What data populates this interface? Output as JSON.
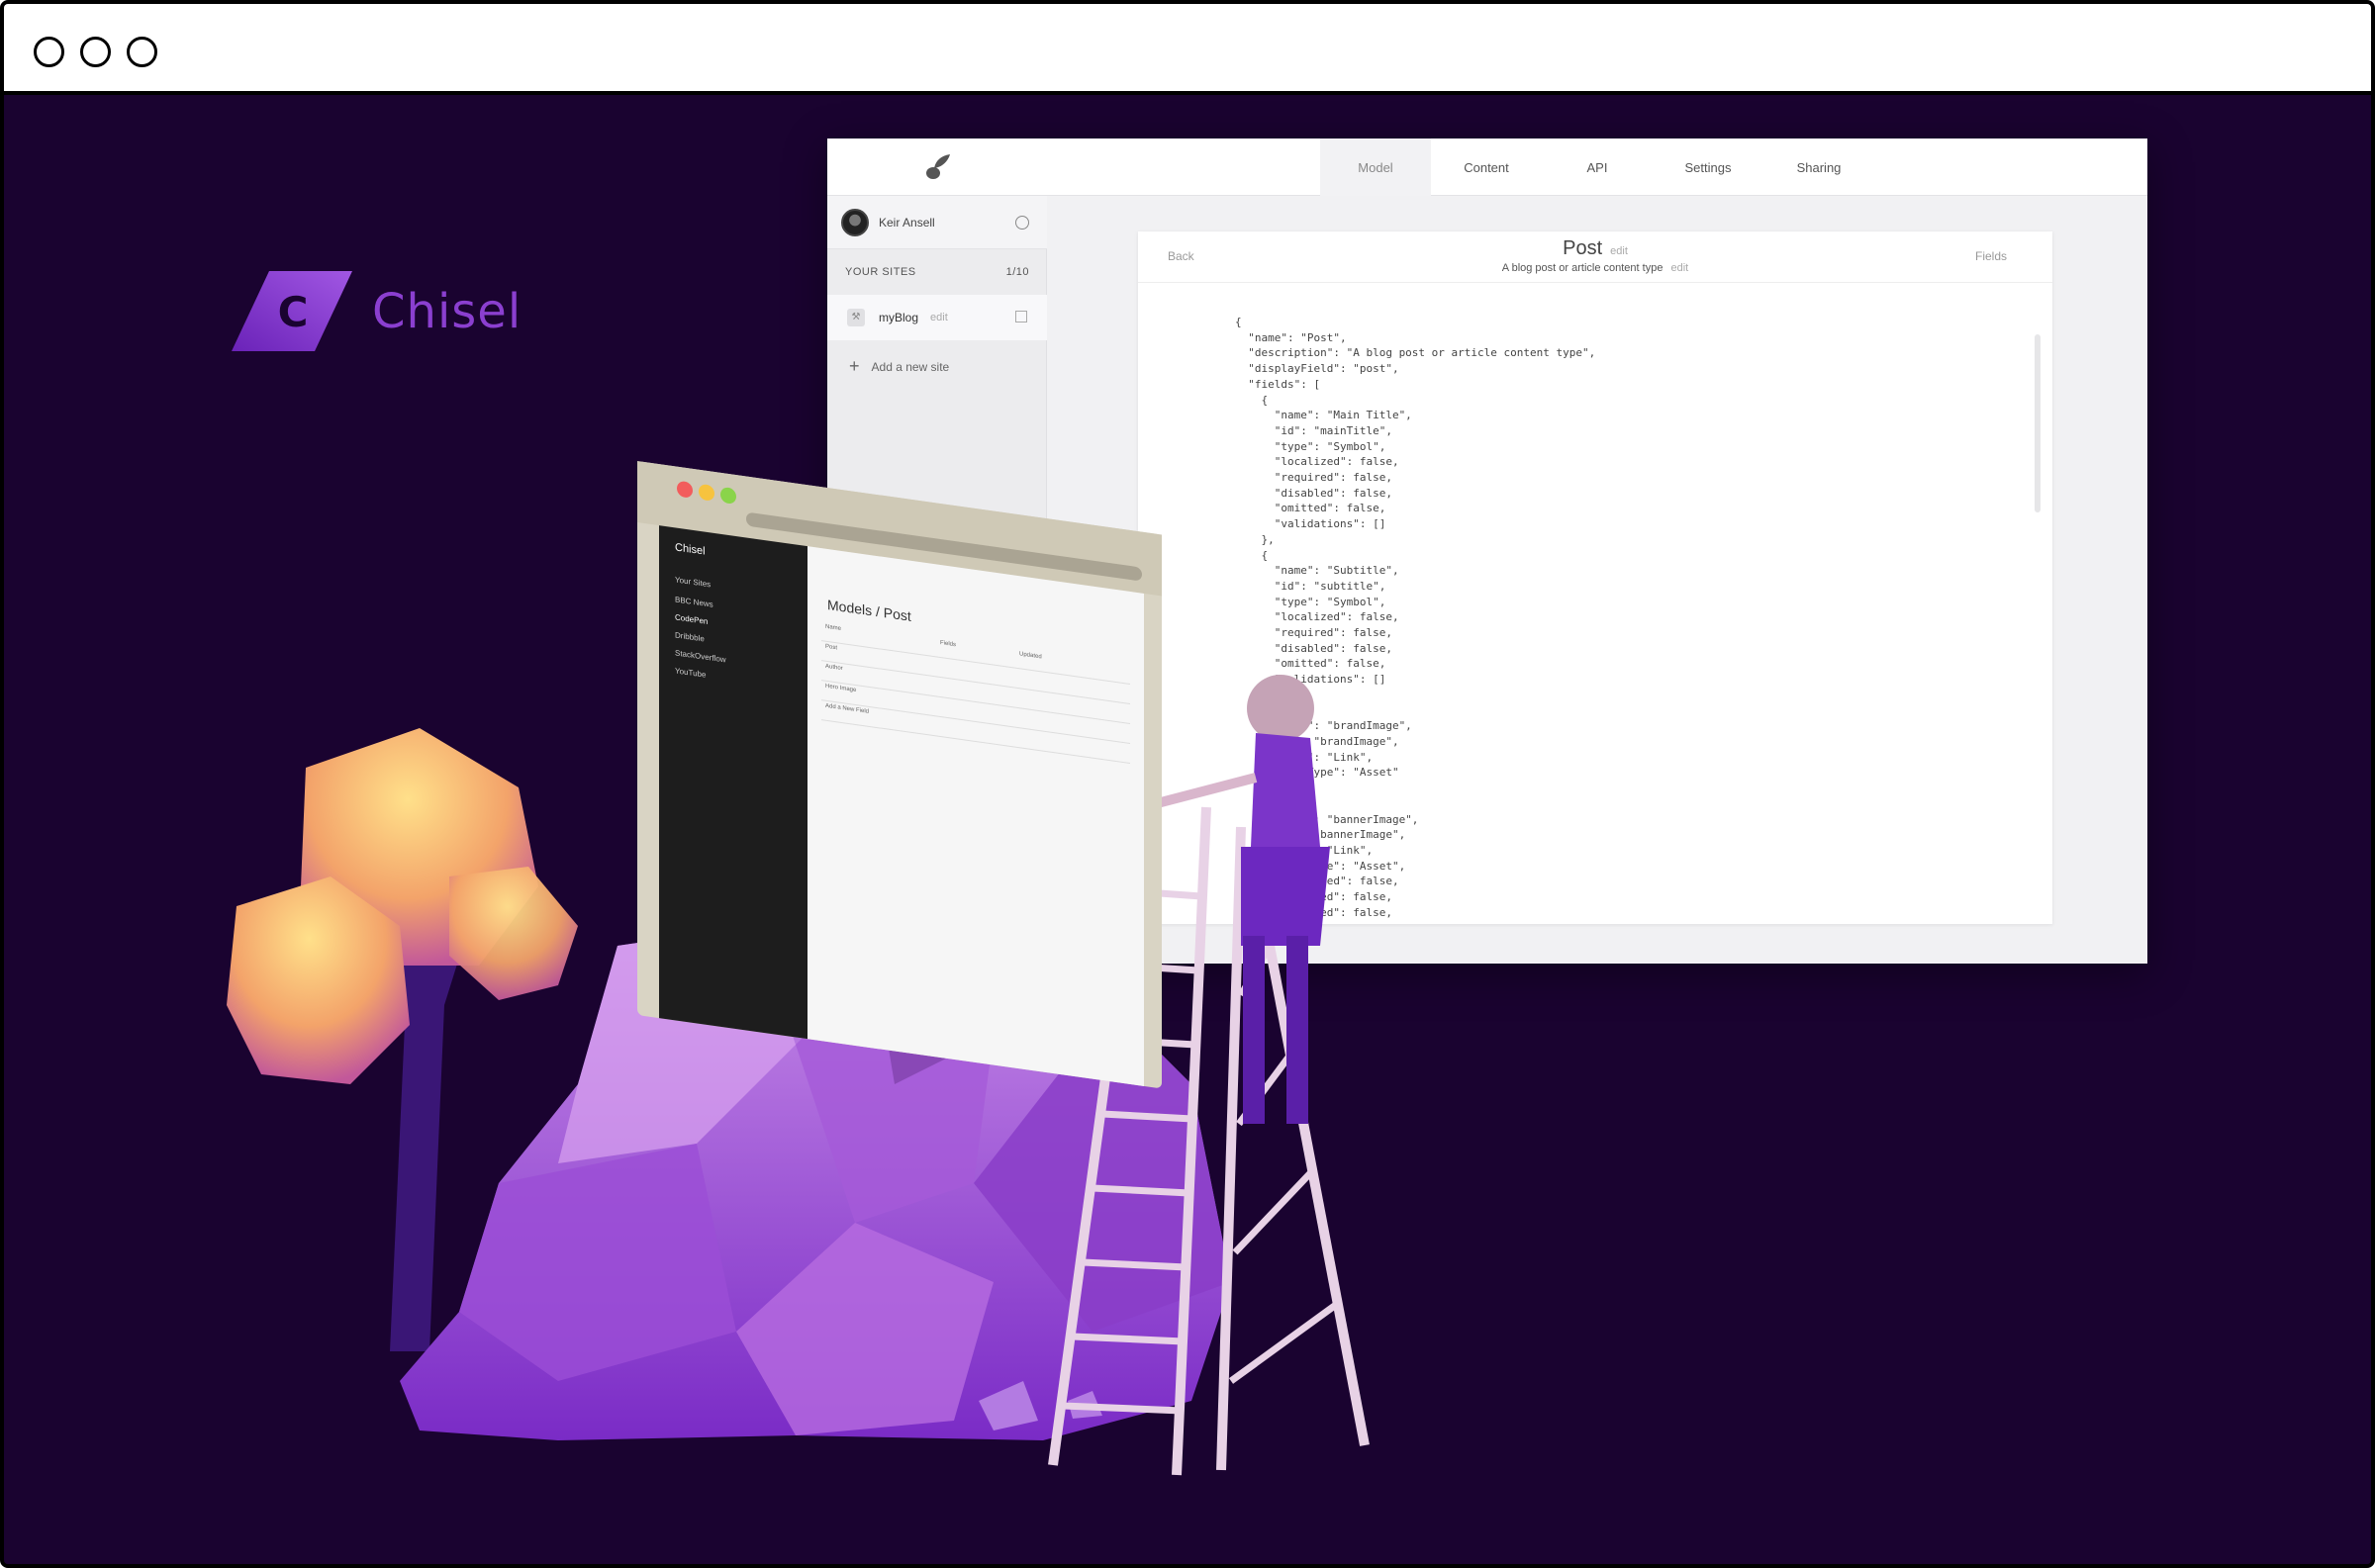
{
  "window": {
    "controls": [
      "close",
      "minimize",
      "maximize"
    ]
  },
  "brand": {
    "name": "Chisel",
    "mark_letter": "C",
    "color": "#8b3fd0"
  },
  "app": {
    "tabs": [
      {
        "label": "Model",
        "active": true
      },
      {
        "label": "Content",
        "active": false
      },
      {
        "label": "API",
        "active": false
      },
      {
        "label": "Settings",
        "active": false
      },
      {
        "label": "Sharing",
        "active": false
      }
    ],
    "user": {
      "name": "Keir Ansell"
    },
    "sites_header": {
      "label": "YOUR SITES",
      "count": "1/10"
    },
    "site": {
      "name": "myBlog",
      "edit": "edit"
    },
    "add_site": "Add a new site",
    "panel": {
      "back": "Back",
      "fields": "Fields",
      "title": "Post",
      "title_edit": "edit",
      "subtitle": "A blog post or article content type",
      "subtitle_edit": "edit",
      "code": "{\n  \"name\": \"Post\",\n  \"description\": \"A blog post or article content type\",\n  \"displayField\": \"post\",\n  \"fields\": [\n    {\n      \"name\": \"Main Title\",\n      \"id\": \"mainTitle\",\n      \"type\": \"Symbol\",\n      \"localized\": false,\n      \"required\": false,\n      \"disabled\": false,\n      \"omitted\": false,\n      \"validations\": []\n    },\n    {\n      \"name\": \"Subtitle\",\n      \"id\": \"subtitle\",\n      \"type\": \"Symbol\",\n      \"localized\": false,\n      \"required\": false,\n      \"disabled\": false,\n      \"omitted\": false,\n      \"validations\": []\n    },\n    {\n      \"name\": \"brandImage\",\n      \"id\": \"brandImage\",\n      \"type\": \"Link\",\n      \"linkType\": \"Asset\"\n    },\n    {\n      \"name\": \"bannerImage\",\n      \"id\": \"bannerImage\",\n      \"type\": \"Link\",\n      \"linkType\": \"Asset\",\n      \"localized\": false,\n      \"required\": false,\n      \"disabled\": false,"
    }
  },
  "mini_browser": {
    "brand": "Chisel",
    "sidebar_title": "Your Sites",
    "sites": [
      "BBC News",
      "CodePen",
      "Dribbble",
      "StackOverflow",
      "YouTube"
    ],
    "heading": "Models / Post",
    "columns": [
      "Name",
      "Fields",
      "Updated"
    ],
    "rows": [
      "Post",
      "Author",
      "Hero Image"
    ],
    "add_row": "Add a New Field"
  }
}
